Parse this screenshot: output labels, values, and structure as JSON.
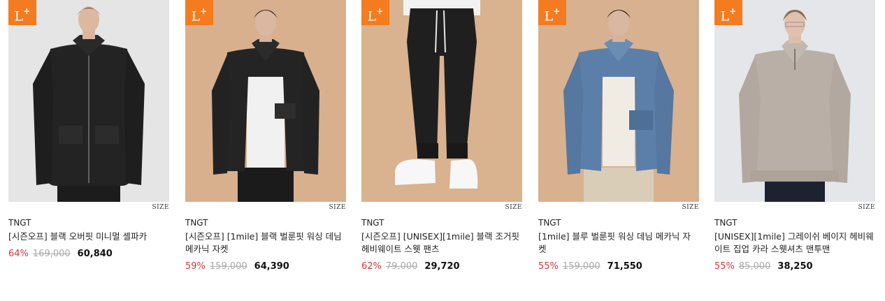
{
  "products": [
    {
      "badge": "L",
      "badge_sup": "+",
      "size_label": "SIZE",
      "brand": "TNGT",
      "title": "[시즌오프] 블랙 오버핏 미니멀 셸파카",
      "discount": "64%",
      "original_price": "169,000",
      "sale_price": "60,840"
    },
    {
      "badge": "L",
      "badge_sup": "+",
      "size_label": "SIZE",
      "brand": "TNGT",
      "title": "[시즌오프] [1mile] 블랙 벌룬핏 워싱 데님 메카닉 자켓",
      "discount": "59%",
      "original_price": "159,000",
      "sale_price": "64,390"
    },
    {
      "badge": "L",
      "badge_sup": "+",
      "size_label": "SIZE",
      "brand": "TNGT",
      "title": "[시즌오프] [UNISEX][1mile] 블랙 조거핏 헤비웨이트 스웻 팬츠",
      "discount": "62%",
      "original_price": "79,000",
      "sale_price": "29,720"
    },
    {
      "badge": "L",
      "badge_sup": "+",
      "size_label": "SIZE",
      "brand": "TNGT",
      "title": "[1mile] 블루 벌룬핏 워싱 데님 메카닉 자켓",
      "discount": "55%",
      "original_price": "159,000",
      "sale_price": "71,550"
    },
    {
      "badge": "L",
      "badge_sup": "+",
      "size_label": "SIZE",
      "brand": "TNGT",
      "title": "[UNISEX][1mile] 그레이쉬 베이지 헤비웨이트 집업 카라 스웻셔츠 맨투맨",
      "discount": "55%",
      "original_price": "85,000",
      "sale_price": "38,250"
    }
  ],
  "colors": {
    "badge": "#f47b20",
    "discount": "#d9343b",
    "bg_light": "#e6e6e6",
    "bg_tan": "#d9b18f"
  }
}
